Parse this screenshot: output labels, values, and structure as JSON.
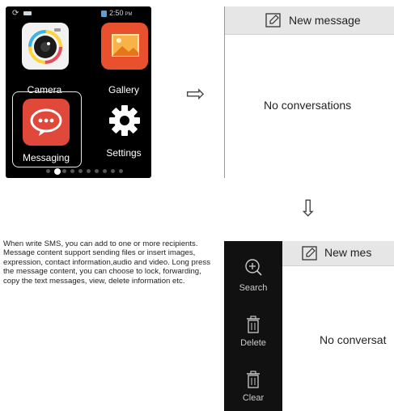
{
  "home": {
    "status_time": "2:50",
    "status_ampm": "PM",
    "apps": [
      {
        "label": "Camera",
        "icon": "camera-icon"
      },
      {
        "label": "Gallery",
        "icon": "gallery-icon"
      },
      {
        "label": "Messaging",
        "icon": "messaging-icon"
      },
      {
        "label": "Settings",
        "icon": "gear-icon"
      }
    ],
    "page_count": 10,
    "active_page": 1
  },
  "message_screen": {
    "header_label": "New message",
    "empty_text": "No conversations"
  },
  "description": "When write SMS, you can add to one or more recipients. Message content support sending files or insert images, expression, contact information,audio and video. Long press the message content, you can choose to lock, forwarding, copy the text messages, view, delete information etc.",
  "menu_screen": {
    "menu_items": [
      {
        "label": "Search",
        "icon": "zoom-in-icon"
      },
      {
        "label": "Delete",
        "icon": "trash-icon"
      },
      {
        "label": "Clear",
        "icon": "trash-icon"
      }
    ],
    "header_label": "New mes",
    "empty_text": "No conversat"
  },
  "colors": {
    "camera_tile": "#f2f2f2",
    "gallery_tile": "#e8502e",
    "messaging_tile": "#e0483a",
    "header_bg": "#e6e6e6",
    "menu_bg": "#111111"
  }
}
